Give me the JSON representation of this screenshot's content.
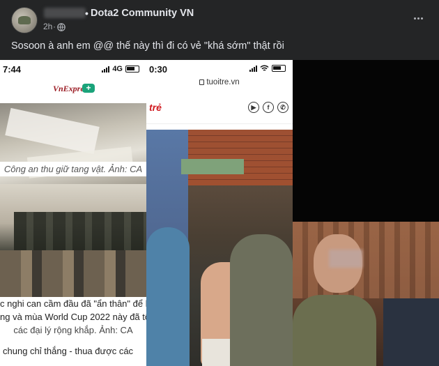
{
  "post": {
    "group_name": "Dota2 Community VN",
    "time": "2h",
    "time_separator": "·",
    "name_separator": "•",
    "text": "Sosoon à anh em @@ thế này thì đi có vẻ \"khá sớm\" thật rồi"
  },
  "icons": {
    "privacy": "public-globe-icon",
    "more": "more-options-icon"
  },
  "media": {
    "panel1": {
      "status_time": "7:44",
      "network": "4G",
      "logo_text": "VnExpress",
      "plus_badge": "+",
      "caption": "Công an thu giữ tang vật. Ảnh: CA",
      "text_lines": [
        "c nghi can cầm đầu đã \"ẩn thân\" để h",
        "ng và mùa World Cup 2022 này đã tổ c",
        "các đại lý rộng khắp. Ảnh: CA"
      ],
      "footer_text": "chung chỉ thắng - thua được các"
    },
    "panel2": {
      "status_time": "0:30",
      "url": "tuoitre.vn",
      "logo_text": "trẻ",
      "social_icons": [
        "youtube-icon",
        "facebook-icon",
        "phone-icon"
      ]
    },
    "panel3": {}
  },
  "colors": {
    "background": "#242526",
    "text_primary": "#e4e6eb",
    "text_secondary": "#b0b3b8"
  }
}
